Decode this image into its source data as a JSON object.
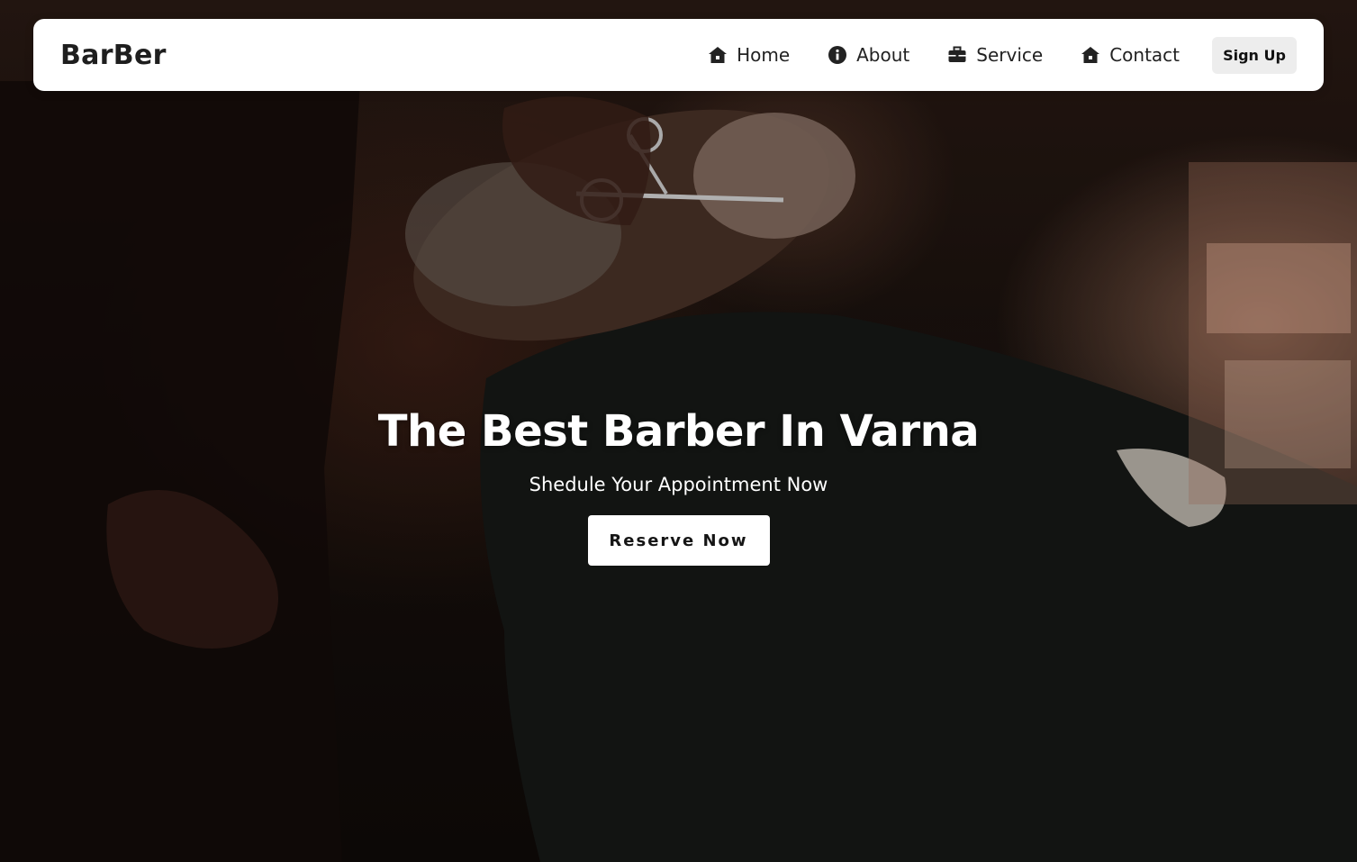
{
  "header": {
    "logo": "BarBer",
    "nav": [
      {
        "label": "Home",
        "icon": "home-icon"
      },
      {
        "label": "About",
        "icon": "info-icon"
      },
      {
        "label": "Service",
        "icon": "briefcase-icon"
      },
      {
        "label": "Contact",
        "icon": "home-icon"
      }
    ],
    "signup_label": "Sign Up"
  },
  "hero": {
    "title": "The Best Barber In Varna",
    "subtitle": "Shedule Your Appointment Now",
    "cta_label": "Reserve Now",
    "background": "barber-trimming-beard-photo"
  },
  "colors": {
    "navbar_bg": "#ffffff",
    "text_dark": "#1e1e1e",
    "signup_bg": "#ededed",
    "hero_text": "#ffffff"
  }
}
